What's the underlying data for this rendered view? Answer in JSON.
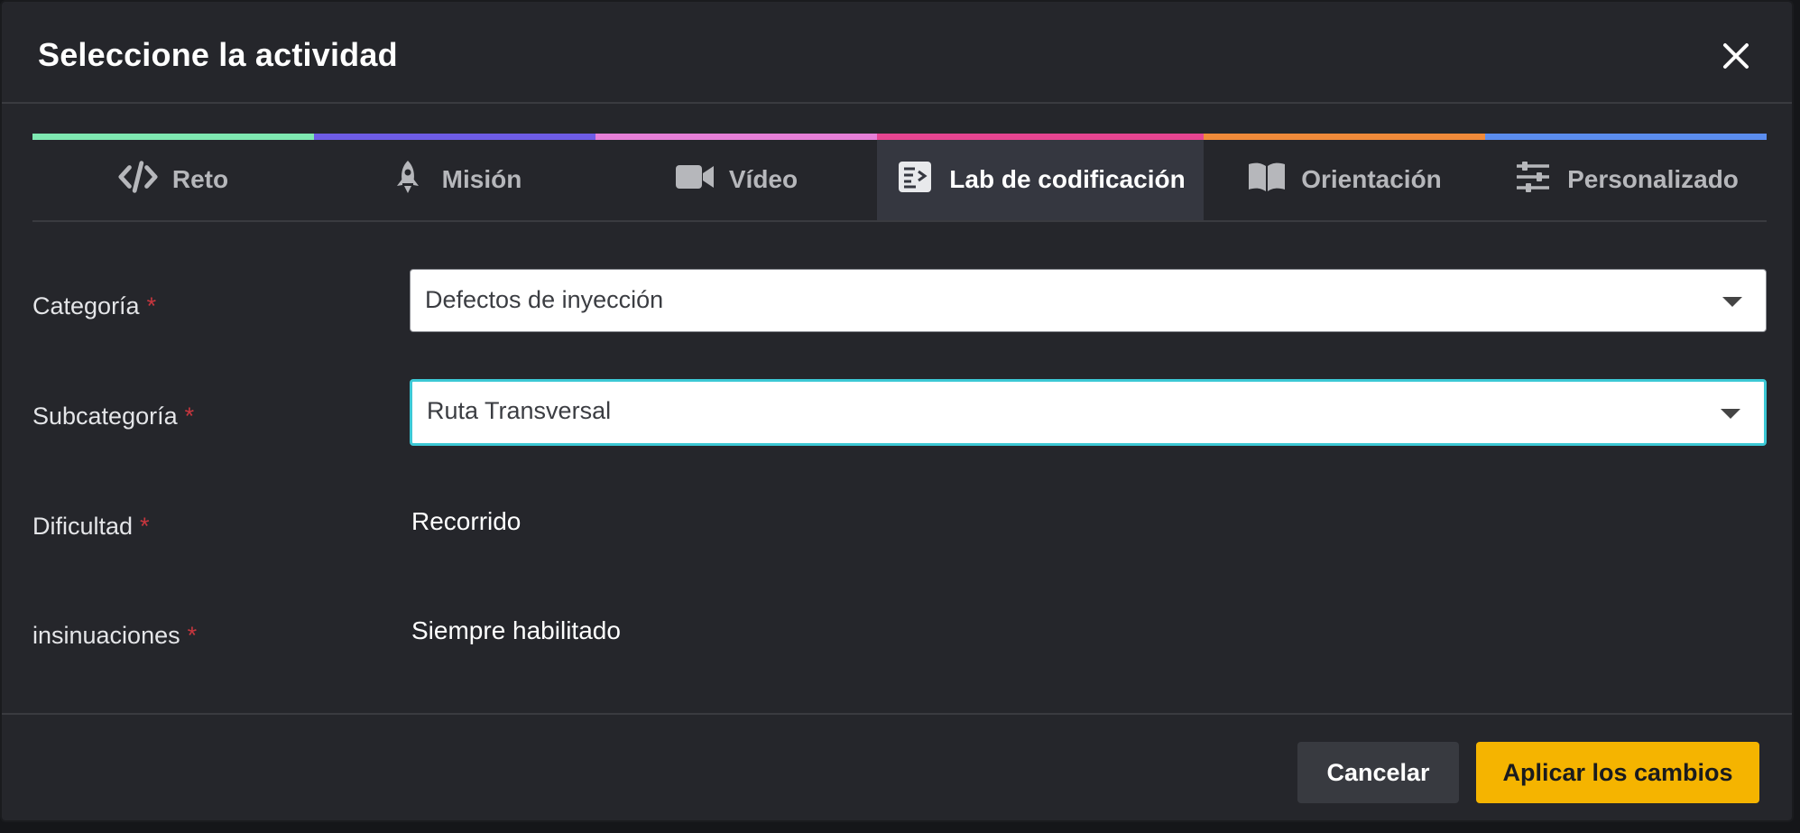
{
  "dialog": {
    "title": "Seleccione la actividad",
    "close_icon": "close-icon"
  },
  "tabs": [
    {
      "label": "Reto",
      "icon": "code-icon",
      "color": "#7ee8b1",
      "active": false
    },
    {
      "label": "Misión",
      "icon": "rocket-icon",
      "color": "#6e5ce6",
      "active": false
    },
    {
      "label": "Vídeo",
      "icon": "video-camera-icon",
      "color": "#e67fd7",
      "active": false
    },
    {
      "label": "Lab de codificación",
      "icon": "code-lab-icon",
      "color": "#e64591",
      "active": true
    },
    {
      "label": "Orientación",
      "icon": "book-icon",
      "color": "#f08a3a",
      "active": false
    },
    {
      "label": "Personalizado",
      "icon": "sliders-icon",
      "color": "#5b8def",
      "active": false
    }
  ],
  "form": {
    "required_mark": "*",
    "categoria": {
      "label": "Categoría",
      "value": "Defectos de inyección"
    },
    "subcategoria": {
      "label": "Subcategoría",
      "value": "Ruta Transversal"
    },
    "dificultad": {
      "label": "Dificultad",
      "value": "Recorrido"
    },
    "insinuaciones": {
      "label": "insinuaciones",
      "value": "Siempre habilitado"
    }
  },
  "footer": {
    "cancel_label": "Cancelar",
    "apply_label": "Aplicar los cambios"
  },
  "colors": {
    "background": "#25262b",
    "accent_focus": "#3cc8d5",
    "primary_button": "#f5b400",
    "required": "#c7363e"
  }
}
